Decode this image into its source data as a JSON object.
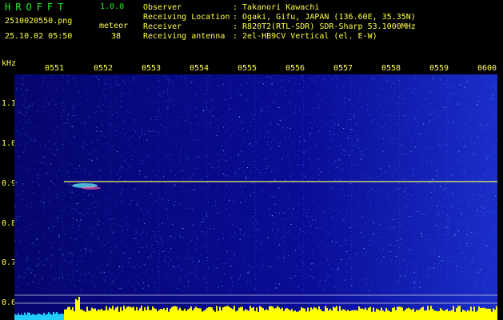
{
  "header": {
    "app_title": "HROFFT",
    "app_version": "1.0.0",
    "filename": "2510020550.png",
    "meteor_label": "meteor",
    "meteor_count": "38",
    "datetime": "25.10.02 05:50"
  },
  "info": [
    {
      "label": "Observer",
      "value": ": Takanori Kawachi"
    },
    {
      "label": "Receiving Location",
      "value": ": Ogaki, Gifu, JAPAN (136.60E, 35.35N)"
    },
    {
      "label": "Receiver",
      "value": ": R820T2(RTL-SDR) SDR-Sharp 53.1000MHz"
    },
    {
      "label": "Receiving antenna",
      "value": ": 2el-HB9CV Vertical (el. E-W)"
    }
  ],
  "axis": {
    "unit": "kHz",
    "x_ticks": [
      "0551",
      "0552",
      "0553",
      "0554",
      "0555",
      "0556",
      "0557",
      "0558",
      "0559",
      "0600"
    ],
    "y_ticks": [
      "1.1",
      "1.0",
      "0.9",
      "0.8",
      "0.7",
      "0.6"
    ]
  },
  "colors": {
    "background": "#000000",
    "spectrum_base": "#0a0a8c",
    "carrier_line": "#ffdd44",
    "noise_bar": "#ffff00",
    "noise_bar_low": "#22ccff",
    "label_text": "#ffff44",
    "title_text": "#22ee22"
  }
}
